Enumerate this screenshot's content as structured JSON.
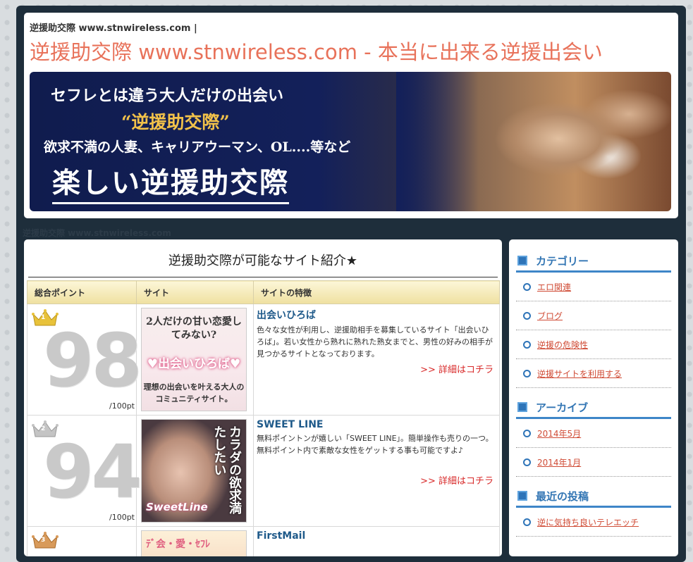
{
  "header": {
    "small_title": "逆援助交際 www.stnwireless.com |",
    "title": "逆援助交際 www.stnwireless.com - 本当に出来る逆援出会い",
    "banner": {
      "line1": "セフレとは違う大人だけの出会い",
      "line2": "“逆援助交際”",
      "line3": "欲求不満の人妻、キャリアウーマン、OL....等など",
      "line4": "楽しい逆援助交際"
    },
    "sub_strip": "逆援助交際 www.stnwireless.com"
  },
  "main": {
    "heading": "逆援助交際が可能なサイト紹介★",
    "columns": [
      "総合ポイント",
      "サイト",
      "サイトの特徴"
    ],
    "rows": [
      {
        "rank": "1",
        "score": "98",
        "unit": "/100pt",
        "crown_color": "#e8c23a",
        "thumb": {
          "line1": "2人だけの甘い恋愛してみない?",
          "line2": "♥出会いひろば♥",
          "line3": "理想の出会いを叶える大人のコミュニティサイト。"
        },
        "title": "出会いひろば",
        "desc": "色々な女性が利用し、逆援助相手を募集しているサイト「出会いひろば」。若い女性から熟れに熟れた熟女までと、男性の好みの相手が見つかるサイトとなっております。",
        "link": ">> 詳細はコチラ"
      },
      {
        "rank": "2",
        "score": "94",
        "unit": "/100pt",
        "crown_color": "#b8b8b8",
        "thumb": {
          "line1": "カラダの欲求満たしたい",
          "line2": "SweetLine"
        },
        "title": "SWEET LINE",
        "desc": "無料ポイントンが嬉しい「SWEET LINE」。簡単操作も売りの一つ。無料ポイント内で素敵な女性をゲットする事も可能ですよ♪",
        "link": ">> 詳細はコチラ"
      },
      {
        "rank": "3",
        "score": "",
        "unit": "",
        "crown_color": "#d89a5a",
        "thumb": {
          "line1": "ﾃﾞ会・愛・ｾﾌﾚ"
        },
        "title": "FirstMail",
        "desc": "",
        "link": ""
      }
    ]
  },
  "sidebar": {
    "categories": {
      "title": "カテゴリー",
      "items": [
        "エロ関連",
        "ブログ",
        "逆援の危険性",
        "逆援サイトを利用する"
      ]
    },
    "archive": {
      "title": "アーカイブ",
      "items": [
        "2014年5月",
        "2014年1月"
      ]
    },
    "recent": {
      "title": "最近の投稿",
      "items": [
        "逆に気持ち良いテレエッチ"
      ]
    }
  }
}
